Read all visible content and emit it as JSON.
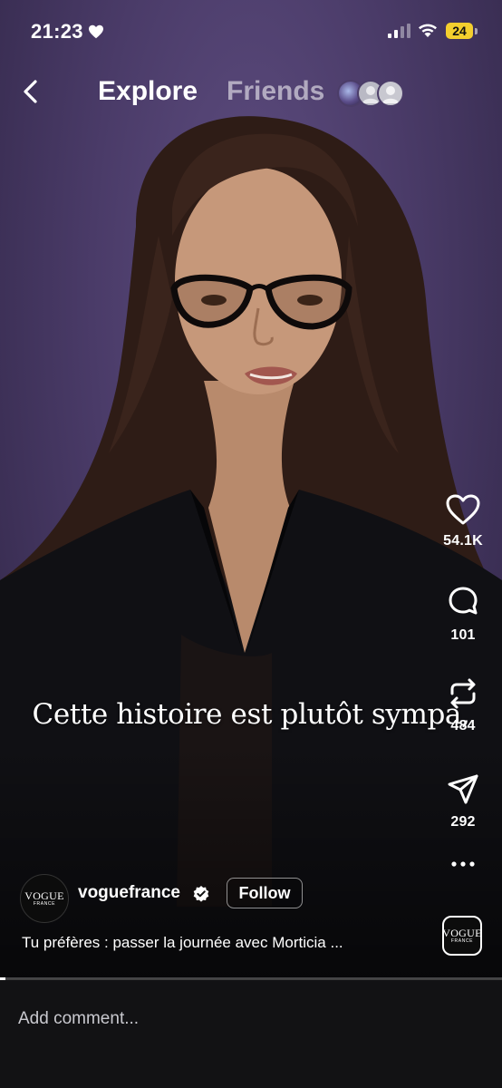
{
  "status_bar": {
    "time": "21:23",
    "battery": "24",
    "battery_color": "#f4cf2e"
  },
  "nav": {
    "back_icon": "chevron-left-icon",
    "tabs": [
      {
        "label": "Explore",
        "active": true
      },
      {
        "label": "Friends",
        "active": false
      }
    ]
  },
  "video": {
    "caption": "Cette histoire est plutôt sympa,",
    "progress": 0.01
  },
  "actions": {
    "like": {
      "icon": "heart-icon",
      "count": "54.1K"
    },
    "comment": {
      "icon": "comment-icon",
      "count": "101"
    },
    "repost": {
      "icon": "repost-icon",
      "count": "484"
    },
    "share": {
      "icon": "send-icon",
      "count": "292"
    },
    "more": {
      "icon": "more-icon"
    }
  },
  "author": {
    "avatar_logo": "VOGUE",
    "avatar_logo_sub": "FRANCE",
    "username": "voguefrance",
    "verified": true,
    "follow_label": "Follow"
  },
  "description": "Tu préfères : passer la journée avec Morticia ...",
  "audio": {
    "logo": "VOGUE",
    "logo_sub": "FRANCE"
  },
  "comment_bar": {
    "placeholder": "Add comment..."
  },
  "colors": {
    "background": "#000000",
    "video_backdrop": "#4a3b68",
    "comment_bar": "#121214"
  }
}
